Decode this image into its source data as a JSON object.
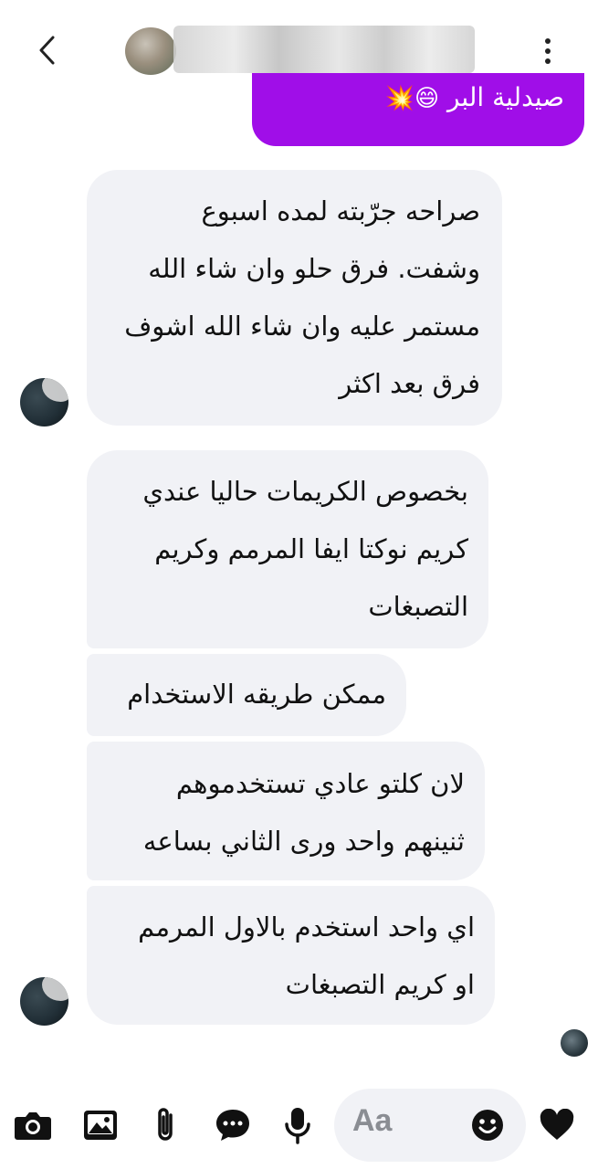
{
  "header": {
    "back_icon": "chevron-left-icon",
    "menu_icon": "more-vertical-icon"
  },
  "sent_message": {
    "text": "صيدلية البر",
    "emojis": "😄💥"
  },
  "received_messages": [
    {
      "lines": [
        "صراحه جرّبته لمده اسبوع",
        "وشفت. فرق حلو  وان شاء الله",
        "مستمر عليه وان شاء الله اشوف",
        "فرق بعد اكثر"
      ]
    },
    {
      "lines": [
        "بخصوص الكريمات حاليا عندي",
        "كريم نوكتا ايفا المرمم وكريم",
        "التصبغات"
      ]
    },
    {
      "lines": [
        "ممكن طريقه الاستخدام"
      ]
    },
    {
      "lines": [
        "لان كلتو عادي تستخدموهم",
        "ثنينهم واحد ورى الثاني بساعه"
      ]
    },
    {
      "lines": [
        "اي واحد استخدم بالاول المرمم",
        "او كريم التصبغات"
      ]
    }
  ],
  "composer": {
    "placeholder": "Aa",
    "icons": [
      "camera-icon",
      "image-icon",
      "attachment-icon",
      "chat-bubble-icon",
      "microphone-icon",
      "emoji-icon",
      "heart-icon"
    ]
  },
  "colors": {
    "sent_bubble": "#a00ee8",
    "received_bubble": "#f1f2f6",
    "icon": "#111111"
  }
}
